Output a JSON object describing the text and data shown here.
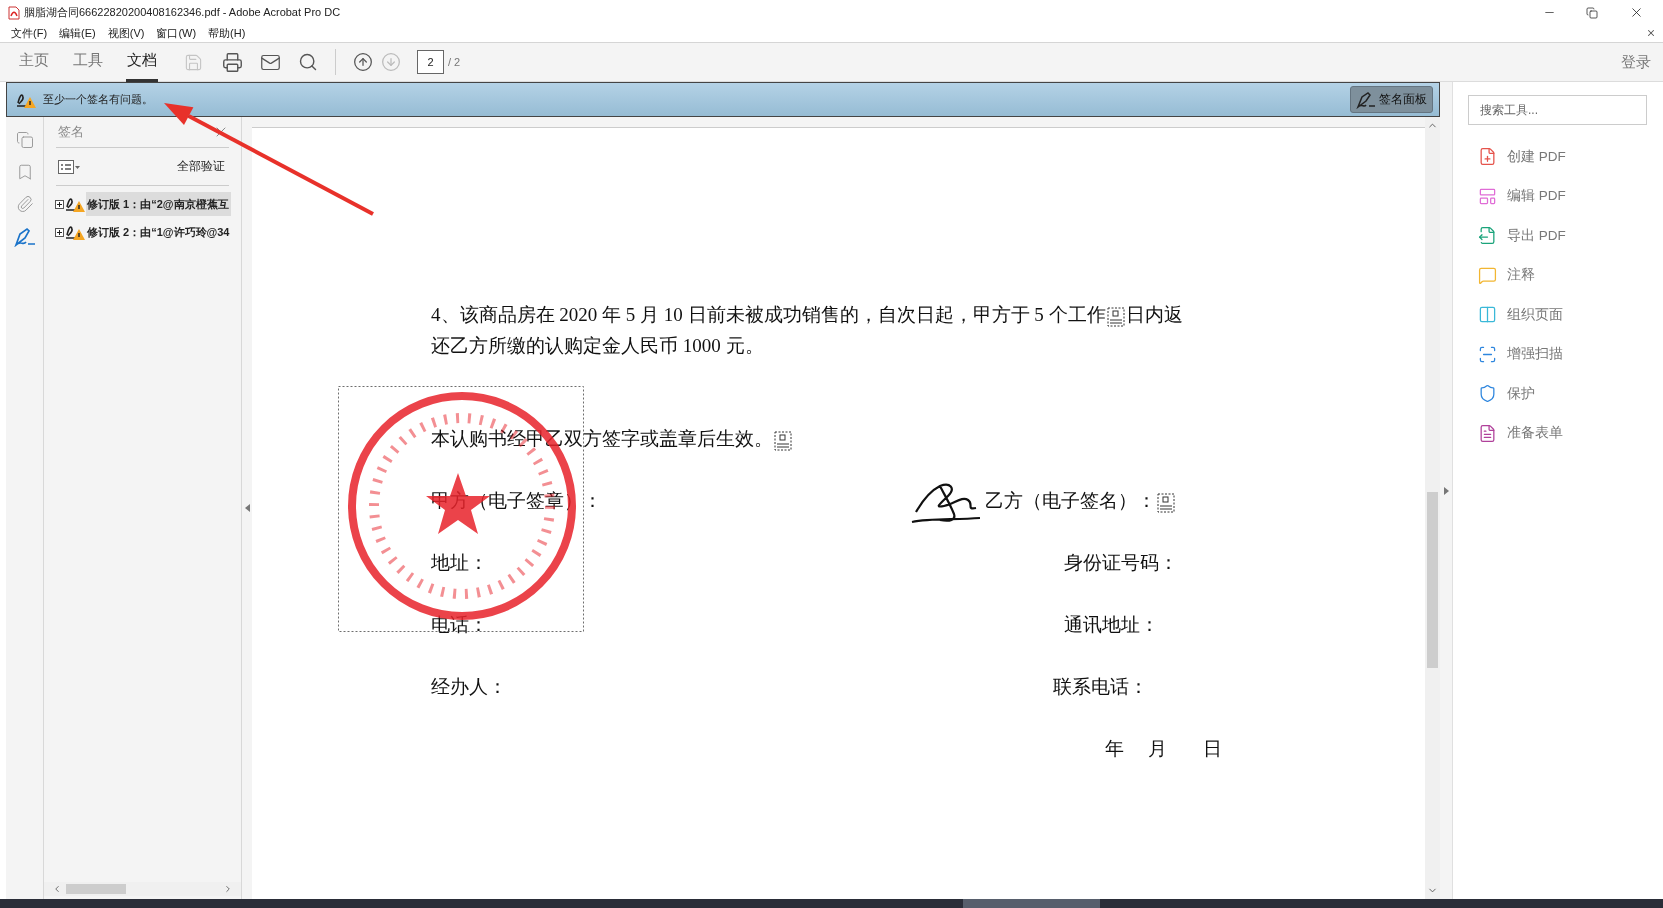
{
  "window": {
    "title": "胭脂湖合同66622820200408162346.pdf - Adobe Acrobat Pro DC"
  },
  "menu": [
    "文件(F)",
    "编辑(E)",
    "视图(V)",
    "窗口(W)",
    "帮助(H)"
  ],
  "toolbar": {
    "tabs": [
      {
        "label": "主页",
        "selected": false
      },
      {
        "label": "工具",
        "selected": false
      },
      {
        "label": "文档",
        "selected": true
      }
    ],
    "page_input": "2",
    "page_total": "/ 2",
    "sign_in": "登录"
  },
  "banner": {
    "message": "至少一个签名有问题。",
    "button": "签名面板"
  },
  "signatures_panel": {
    "title": "签名",
    "verify_all": "全部验证",
    "items": [
      {
        "label": "修订版 1：由“2@南京橙蕉互",
        "selected": true,
        "expanded": false
      },
      {
        "label": "修订版 2：由“1@许巧玲@34",
        "selected": false,
        "expanded": false
      }
    ]
  },
  "document": {
    "lines": [
      {
        "segments": [
          "4、该商品房在 2020 年 5 月 10 日前未被成功销售的，自次日起，甲方于 5 个工作",
          "日内返"
        ],
        "trailing_sep": false
      },
      {
        "segments": [
          "还乙方所缴的认购定金人民币 1000 元。"
        ],
        "trailing_sep": false
      },
      {
        "segments": [
          "本认购书经甲乙双方签字或盖章后生效。"
        ],
        "trailing_sep": true
      }
    ],
    "rows": [
      {
        "left": "甲方（电子签章）：",
        "right": "乙方（电子签名）：",
        "right_sep": true
      },
      {
        "left": "地址：",
        "right": "身份证号码：",
        "right_sep": false
      },
      {
        "left": "电话：",
        "right": "通讯地址：",
        "right_sep": false
      },
      {
        "left": "经办人：",
        "right": "联系电话：",
        "right_sep": false
      }
    ],
    "date": [
      "年",
      "月",
      "日"
    ]
  },
  "tools": {
    "search_placeholder": "搜索工具...",
    "items": [
      {
        "label": "创建 PDF",
        "kind": "create"
      },
      {
        "label": "编辑 PDF",
        "kind": "edit"
      },
      {
        "label": "导出 PDF",
        "kind": "export"
      },
      {
        "label": "注释",
        "kind": "comment"
      },
      {
        "label": "组织页面",
        "kind": "organize"
      },
      {
        "label": "增强扫描",
        "kind": "scan"
      },
      {
        "label": "保护",
        "kind": "protect"
      },
      {
        "label": "准备表单",
        "kind": "form"
      }
    ]
  }
}
